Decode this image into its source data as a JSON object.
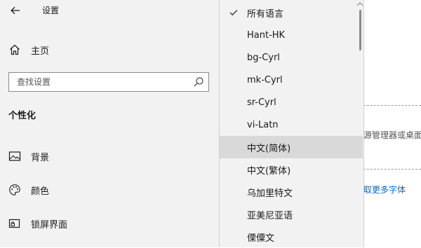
{
  "window": {
    "title": "设置"
  },
  "sidebar": {
    "home_label": "主页",
    "search_placeholder": "查找设置",
    "section_heading": "个性化",
    "items": [
      {
        "label": "背景",
        "icon": "image-icon"
      },
      {
        "label": "颜色",
        "icon": "palette-icon"
      },
      {
        "label": "锁屏界面",
        "icon": "lock-screen-icon"
      }
    ]
  },
  "content": {
    "partial_text": "源管理器或桌面",
    "partial_link": "取更多字体"
  },
  "dropdown": {
    "selected_index": 0,
    "highlighted_index": 6,
    "options": [
      "所有语言",
      "Hant-HK",
      "bg-Cyrl",
      "mk-Cyrl",
      "sr-Cyrl",
      "vi-Latn",
      "中文(简体)",
      "中文(繁体)",
      "乌加里特文",
      "亚美尼亚语",
      "傈僳文"
    ]
  },
  "colors": {
    "accent_link": "#0a67c6",
    "pane_background": "#f2f2f2",
    "highlight": "#d9d9d9"
  }
}
